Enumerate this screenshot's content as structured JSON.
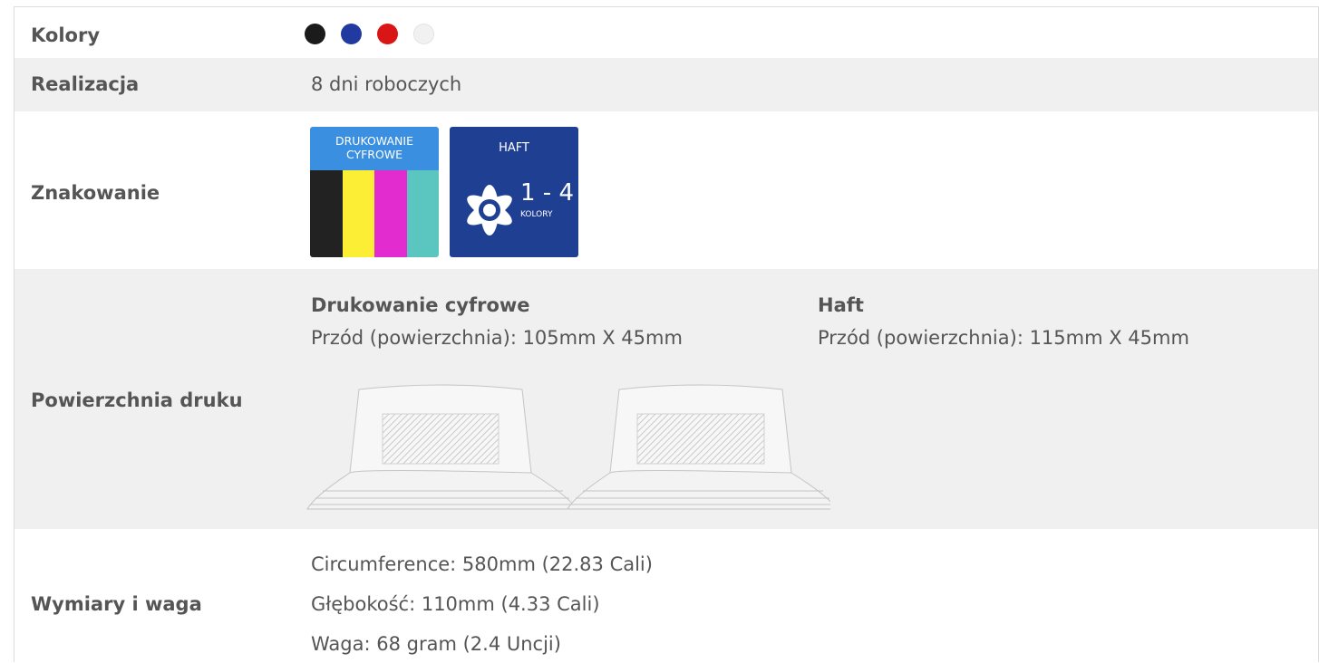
{
  "colors_row": {
    "label": "Kolory",
    "swatches": [
      "#1b1b1b",
      "#213aa0",
      "#d91515",
      "#f1f1f1"
    ]
  },
  "lead_time_row": {
    "label": "Realizacja",
    "value": "8 dni roboczych"
  },
  "marking_row": {
    "label": "Znakowanie",
    "digital_badge": {
      "line1": "DRUKOWANIE",
      "line2": "CYFROWE",
      "stripe_colors": [
        "#222222",
        "#fbee35",
        "#e22ccf",
        "#5bc5c0"
      ],
      "header_color": "#3b8fe0"
    },
    "embroidery_badge": {
      "title": "HAFT",
      "range": "1 - 4",
      "unit": "KOLORY",
      "bg_color": "#1f3f92"
    }
  },
  "print_area_row": {
    "label": "Powierzchnia druku",
    "methods": [
      {
        "name": "Drukowanie cyfrowe",
        "dimension": "Przód (powierzchnia): 105mm X 45mm"
      },
      {
        "name": "Haft",
        "dimension": "Przód (powierzchnia): 115mm X 45mm"
      }
    ]
  },
  "dimensions_row": {
    "label": "Wymiary i waga",
    "lines": [
      "Circumference: 580mm (22.83 Cali)",
      "Głębokość: 110mm (4.33 Cali)",
      "Waga: 68 gram (2.4 Uncji)"
    ]
  }
}
